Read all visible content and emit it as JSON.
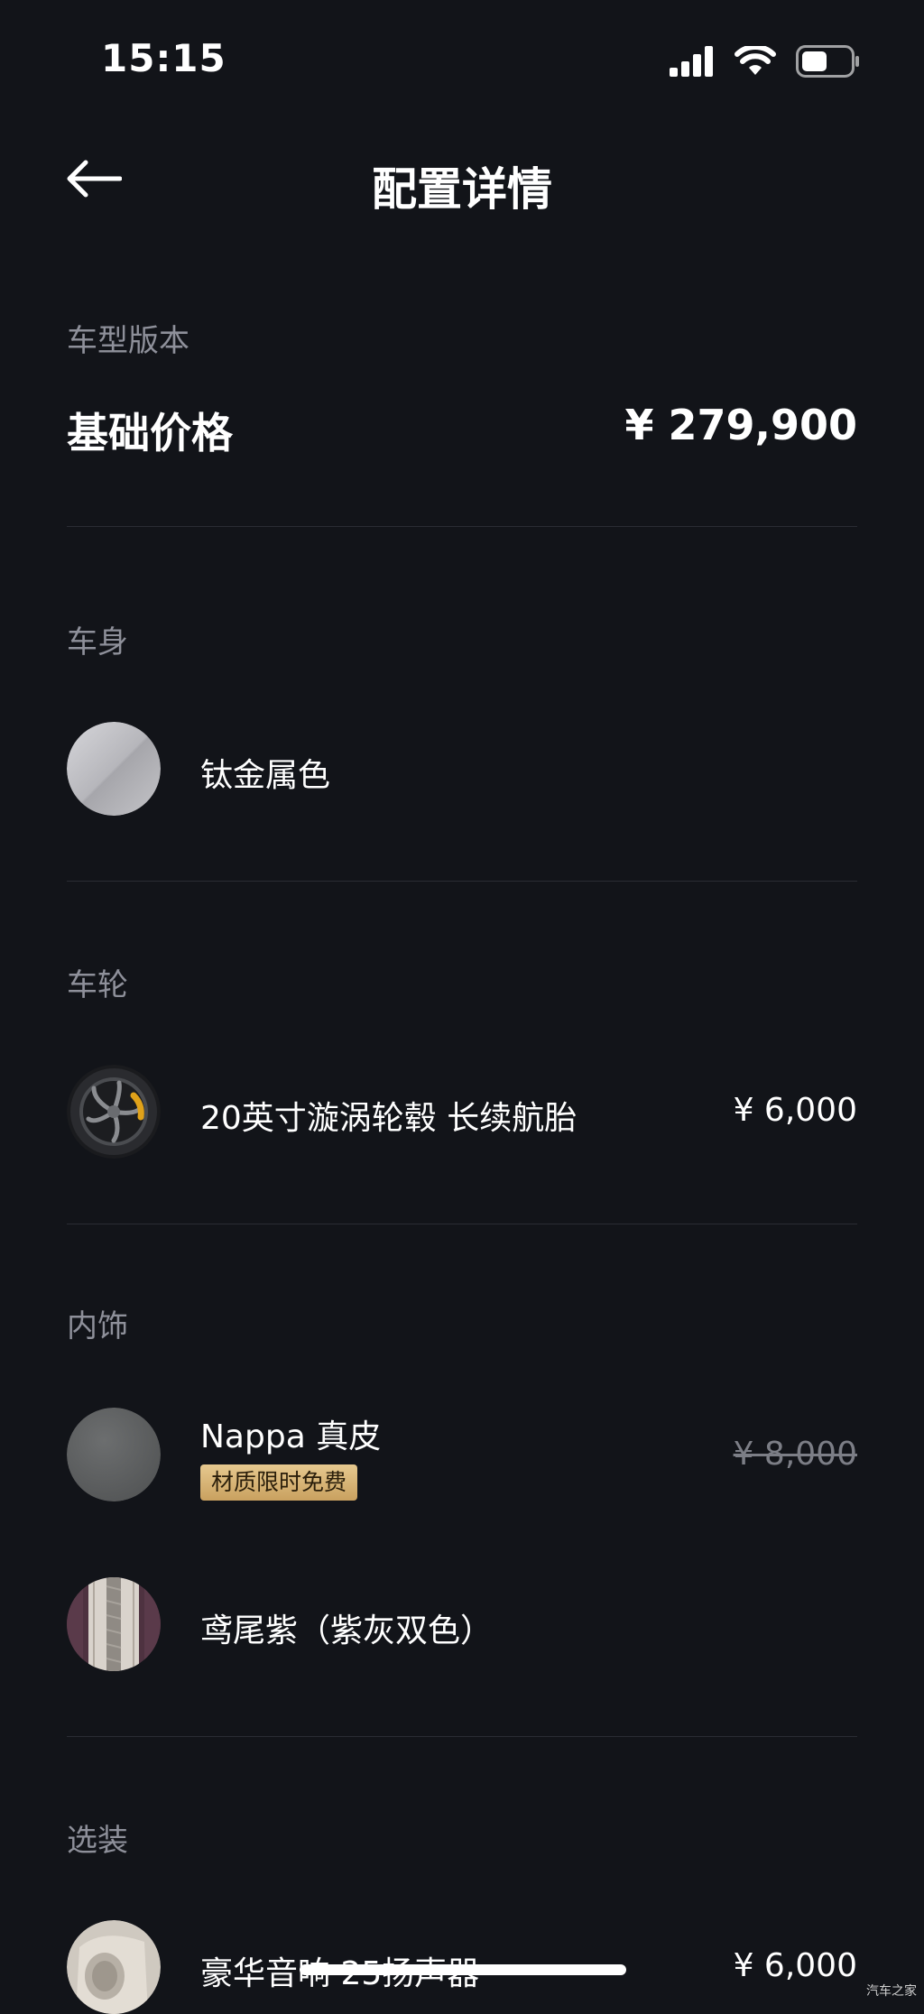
{
  "status_bar": {
    "time": "15:15",
    "icons": [
      "signal-icon",
      "wifi-icon",
      "battery-icon"
    ],
    "battery_level": 0.5
  },
  "header": {
    "back_icon": "arrow-left-icon",
    "title": "配置详情"
  },
  "model_section": {
    "label": "车型版本",
    "base_price_label": "基础价格",
    "base_price": "¥ 279,900"
  },
  "body_section": {
    "label": "车身",
    "item_name": "钛金属色",
    "swatch_color": "#b8b8bd"
  },
  "wheel_section": {
    "label": "车轮",
    "item_name": "20英寸漩涡轮毂 长续航胎",
    "price": "¥ 6,000",
    "accent_color": "#e0a21a"
  },
  "interior_section": {
    "label": "内饰",
    "items": [
      {
        "name": "Nappa 真皮",
        "badge": "材质限时免费",
        "price": "¥ 8,000",
        "price_struck": true,
        "swatch_color": "#5e6061"
      },
      {
        "name": "鸢尾紫（紫灰双色）",
        "swatch_color": "#5a3a4a"
      }
    ]
  },
  "options_section": {
    "label": "选装",
    "item_name": "豪华音响 25扬声器",
    "price": "¥ 6,000"
  },
  "watermark": "汽车之家",
  "colors": {
    "background": "#121419",
    "text_primary": "#ffffff",
    "text_secondary": "#8e909a",
    "divider": "#2a2c33",
    "badge_gold": "#d8b677"
  }
}
